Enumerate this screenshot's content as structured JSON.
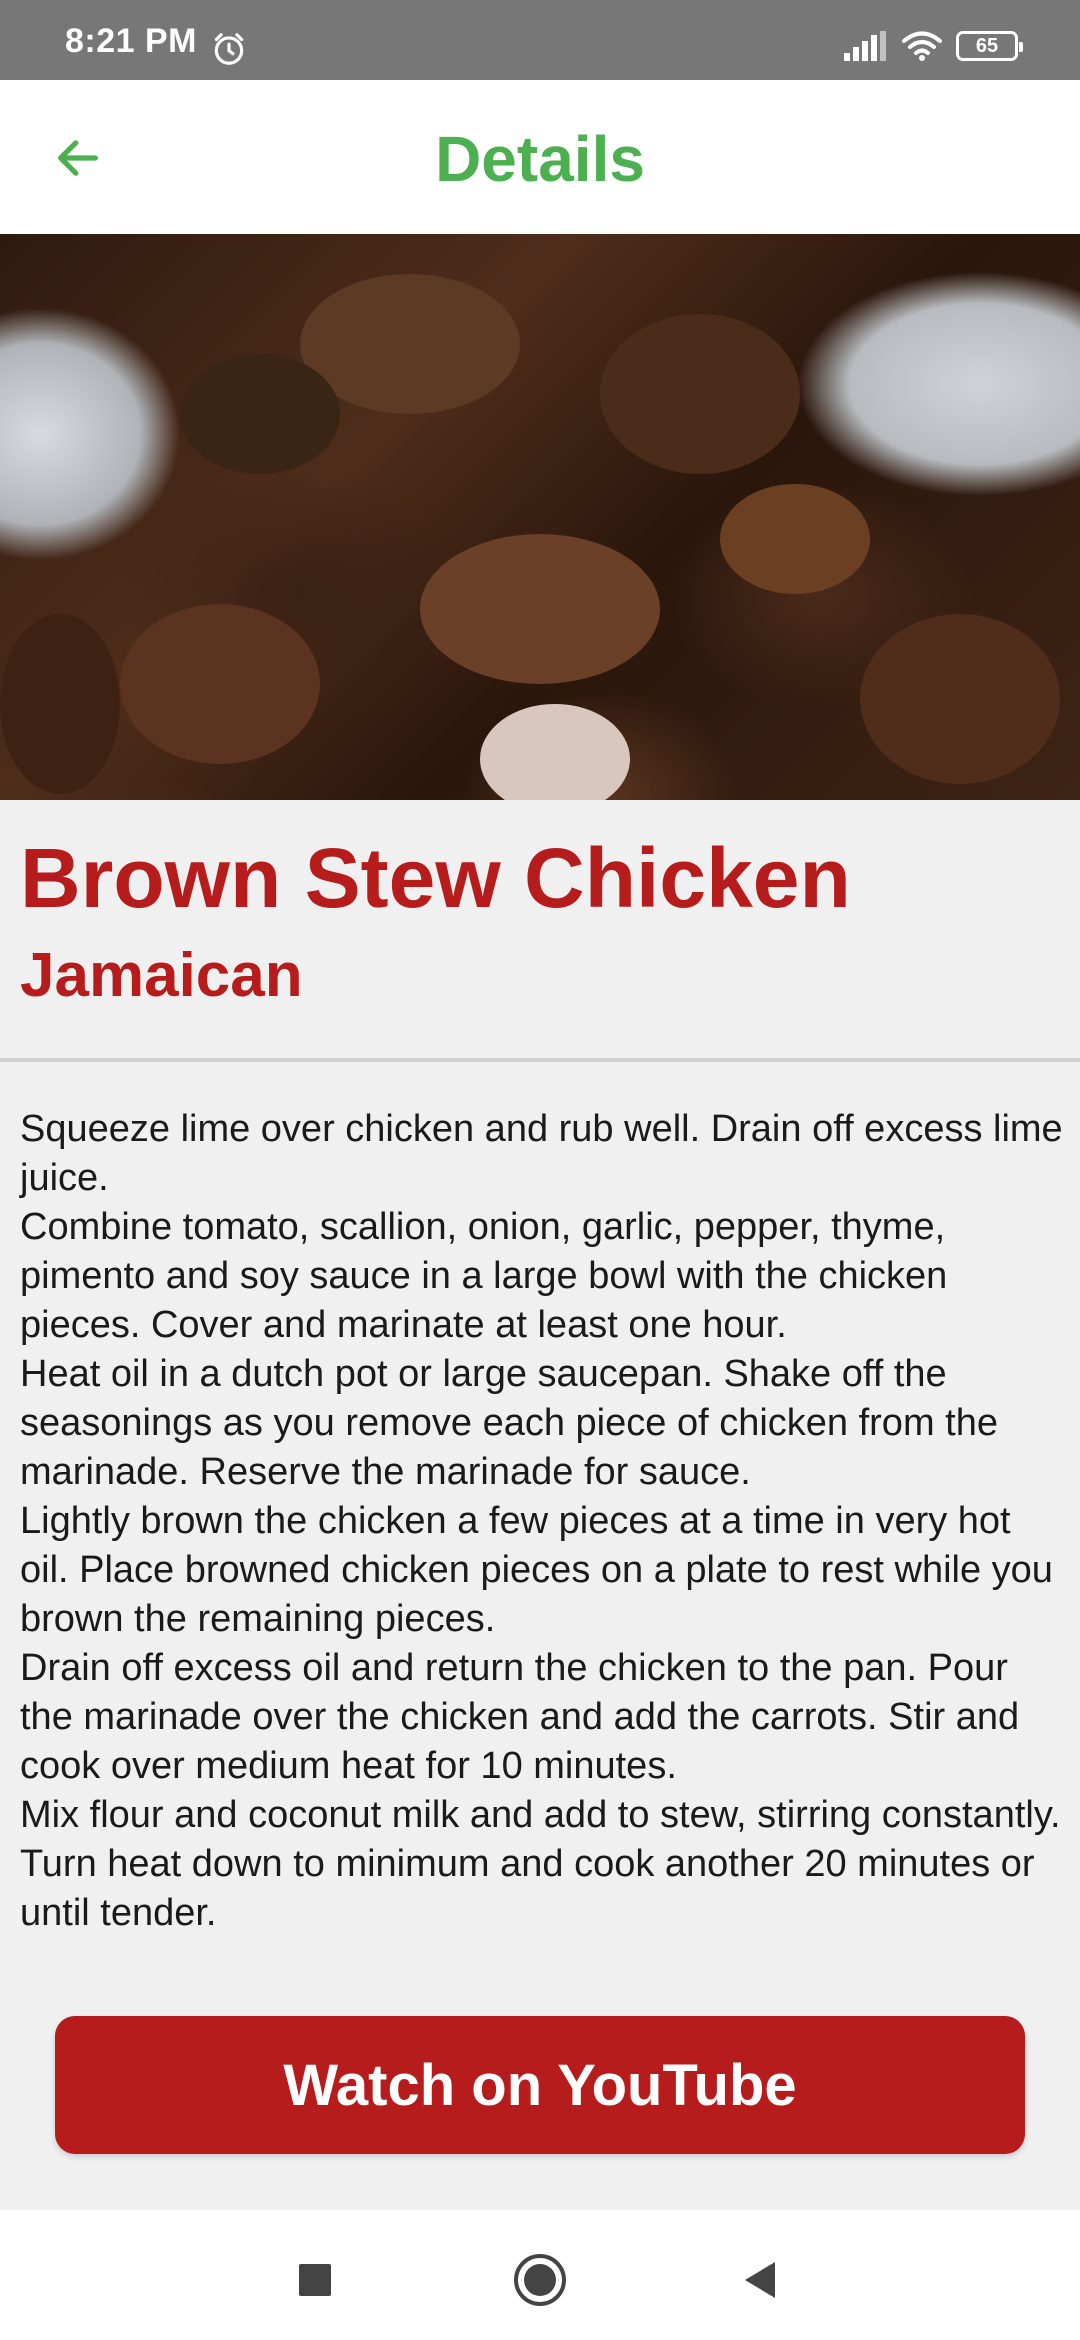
{
  "status_bar": {
    "time": "8:21 PM",
    "battery": "65",
    "icons": [
      "alarm-icon",
      "signal-icon",
      "wifi-icon",
      "battery-icon"
    ]
  },
  "app_bar": {
    "title": "Details",
    "back_icon": "arrow-left-icon",
    "accent_color": "#4caf50"
  },
  "meal": {
    "name": "Brown Stew Chicken",
    "area": "Jamaican",
    "instructions": "Squeeze lime over chicken and rub well. Drain off excess lime juice.\nCombine tomato, scallion, onion, garlic, pepper, thyme, pimento and soy sauce in a large bowl with the chicken pieces. Cover and marinate at least one hour.\nHeat oil in a dutch pot or large saucepan. Shake off the seasonings as you remove each piece of chicken from the marinade. Reserve the marinade for sauce.\nLightly brown the chicken a few pieces at a time in very hot oil. Place browned chicken pieces on a plate to rest while you brown the remaining pieces.\nDrain off excess oil and return the chicken to the pan. Pour the marinade over the chicken and add the carrots. Stir and cook over medium heat for 10 minutes.\nMix flour and coconut milk and add to stew, stirring constantly. Turn heat down to minimum and cook another 20 minutes or until tender.",
    "title_color": "#b71c1c"
  },
  "actions": {
    "youtube_label": "Watch on YouTube",
    "button_color": "#b71c1c"
  },
  "nav_bar": {
    "icons": [
      "recents-square-icon",
      "home-circle-icon",
      "back-triangle-icon"
    ]
  }
}
